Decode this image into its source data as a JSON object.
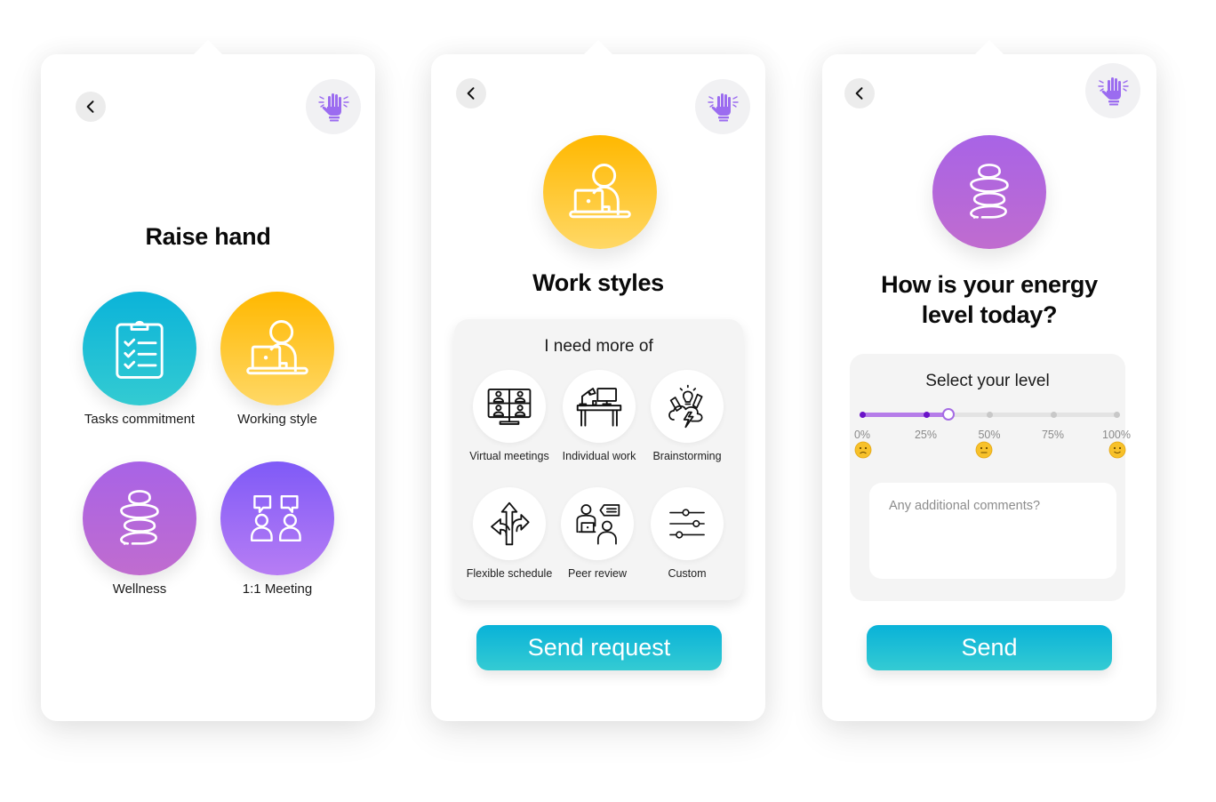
{
  "colors": {
    "cta": "#0bb3d9",
    "accent_purple": "#a56ce4",
    "hand_icon": "#9b6cf0"
  },
  "screens": [
    {
      "title": "Raise hand",
      "back_icon": "chevron-left-icon",
      "raise_hand_icon": "raised-hand-icon",
      "categories": [
        {
          "label": "Tasks commitment",
          "icon": "clipboard-checklist-icon"
        },
        {
          "label": "Working style",
          "icon": "person-laptop-icon"
        },
        {
          "label": "Wellness",
          "icon": "stacked-stones-icon"
        },
        {
          "label": "1:1 Meeting",
          "icon": "two-people-chat-icon"
        }
      ]
    },
    {
      "title": "Work styles",
      "back_icon": "chevron-left-icon",
      "raise_hand_icon": "raised-hand-icon",
      "hero_icon": "person-laptop-icon",
      "panel_title": "I need more of",
      "options": [
        {
          "label": "Virtual meetings",
          "icon": "video-conference-icon"
        },
        {
          "label": "Individual work",
          "icon": "desk-icon"
        },
        {
          "label": "Brainstorming",
          "icon": "brainstorm-icon"
        },
        {
          "label": "Flexible schedule",
          "icon": "split-arrows-icon"
        },
        {
          "label": "Peer review",
          "icon": "peer-review-icon"
        },
        {
          "label": "Custom",
          "icon": "sliders-icon"
        }
      ],
      "button_label": "Send request"
    },
    {
      "title_line1": "How is your energy",
      "title_line2": "level today?",
      "back_icon": "chevron-left-icon",
      "raise_hand_icon": "raised-hand-icon",
      "hero_icon": "stacked-stones-icon",
      "panel_title": "Select your level",
      "slider": {
        "value_percent": 34,
        "ticks": [
          "0%",
          "25%",
          "50%",
          "75%",
          "100%"
        ]
      },
      "emojis": [
        "sad-face-icon",
        "neutral-face-icon",
        "smile-face-icon"
      ],
      "comments_placeholder": "Any additional comments?",
      "comments_value": "",
      "button_label": "Send"
    }
  ]
}
